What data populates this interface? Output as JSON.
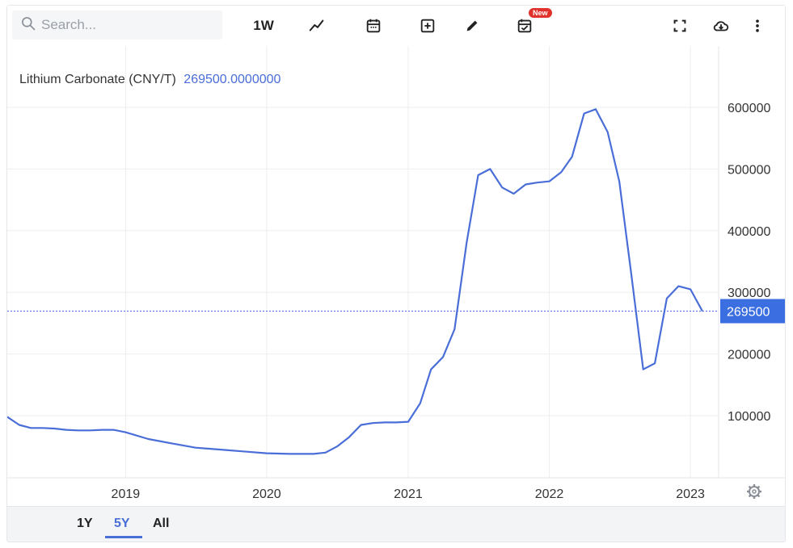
{
  "toolbar": {
    "search_placeholder": "Search...",
    "interval_label": "1W",
    "new_badge": "New",
    "icons": [
      "search-icon",
      "line-chart-icon",
      "calendar-icon",
      "plus-box-icon",
      "pencil-icon",
      "calendar-check-icon",
      "fullscreen-icon",
      "cloud-download-icon",
      "more-vertical-icon"
    ]
  },
  "legend": {
    "name": "Lithium Carbonate (CNY/T)",
    "value": "269500.0000000"
  },
  "price_tag": "269500",
  "range_buttons": [
    {
      "label": "1Y",
      "active": false
    },
    {
      "label": "5Y",
      "active": true
    },
    {
      "label": "All",
      "active": false
    }
  ],
  "colors": {
    "line": "#4a6ed8",
    "tag_bg": "#3b6ee0",
    "grid": "#eceef1"
  },
  "chart_data": {
    "type": "line",
    "series": [
      {
        "name": "Lithium Carbonate (CNY/T)",
        "x": [
          "2018-03-01",
          "2018-04-01",
          "2018-05-01",
          "2018-06-01",
          "2018-07-01",
          "2018-08-01",
          "2018-09-01",
          "2018-10-01",
          "2018-11-01",
          "2018-12-01",
          "2019-01-01",
          "2019-03-01",
          "2019-05-01",
          "2019-07-01",
          "2019-09-01",
          "2019-11-01",
          "2020-01-01",
          "2020-03-01",
          "2020-05-01",
          "2020-06-01",
          "2020-07-01",
          "2020-08-01",
          "2020-09-01",
          "2020-10-01",
          "2020-11-01",
          "2020-12-01",
          "2021-01-01",
          "2021-02-01",
          "2021-03-01",
          "2021-04-01",
          "2021-05-01",
          "2021-06-01",
          "2021-07-01",
          "2021-08-01",
          "2021-09-01",
          "2021-10-01",
          "2021-11-01",
          "2021-12-01",
          "2022-01-01",
          "2022-02-01",
          "2022-03-01",
          "2022-04-01",
          "2022-05-01",
          "2022-06-01",
          "2022-07-01",
          "2022-08-01",
          "2022-09-01",
          "2022-10-01",
          "2022-11-01",
          "2022-12-01",
          "2023-01-01",
          "2023-02-01"
        ],
        "values": [
          98000,
          85000,
          80000,
          80000,
          79000,
          77000,
          76000,
          76000,
          77000,
          77000,
          73000,
          62000,
          55000,
          48000,
          45000,
          42000,
          39000,
          38000,
          38000,
          40000,
          50000,
          65000,
          85000,
          88000,
          89000,
          89000,
          90000,
          120000,
          175000,
          195000,
          240000,
          380000,
          490000,
          500000,
          470000,
          460000,
          475000,
          478000,
          480000,
          495000,
          520000,
          590000,
          597000,
          560000,
          480000,
          330000,
          175000,
          185000,
          290000,
          310000,
          305000,
          269500
        ]
      }
    ],
    "ylim": [
      0,
      650000
    ],
    "yticks": [
      100000,
      200000,
      300000,
      400000,
      500000,
      600000
    ],
    "xticks": [
      "2019",
      "2020",
      "2021",
      "2022",
      "2023"
    ],
    "xlim": [
      "2018-03-01",
      "2023-03-15"
    ],
    "current_value": 269500,
    "grid": true
  }
}
